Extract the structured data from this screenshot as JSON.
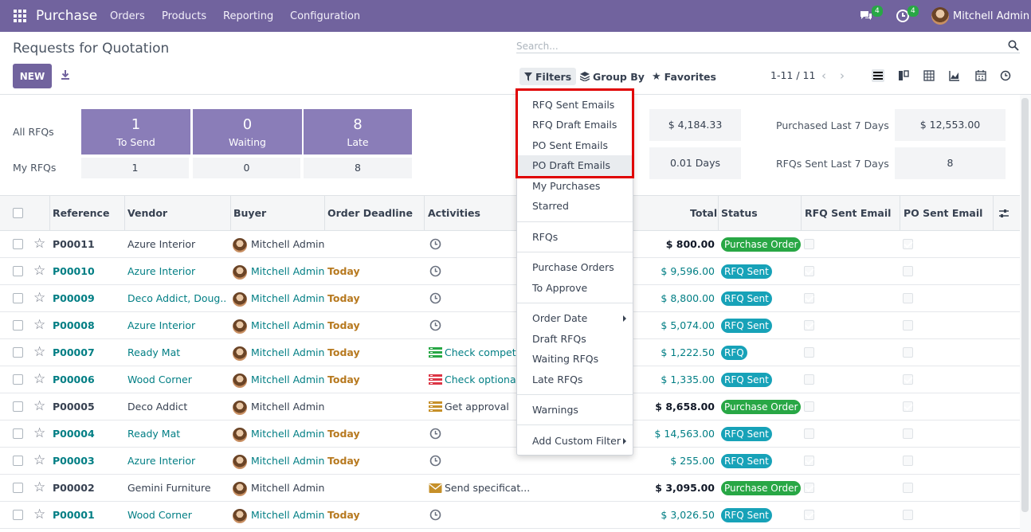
{
  "topbar": {
    "brand": "Purchase",
    "menus": [
      "Orders",
      "Products",
      "Reporting",
      "Configuration"
    ],
    "messages_badge": "4",
    "activities_badge": "4",
    "user": "Mitchell Admin"
  },
  "control": {
    "title": "Requests for Quotation",
    "new_label": "NEW",
    "search_placeholder": "Search...",
    "filters_label": "Filters",
    "groupby_label": "Group By",
    "favorites_label": "Favorites",
    "pager": "1-11 / 11"
  },
  "dashboard": {
    "all_rfqs_label": "All RFQs",
    "my_rfqs_label": "My RFQs",
    "tiles": [
      {
        "value": "1",
        "label": "To Send"
      },
      {
        "value": "0",
        "label": "Waiting"
      },
      {
        "value": "8",
        "label": "Late"
      }
    ],
    "my_values": [
      "1",
      "0",
      "8"
    ],
    "kpis": {
      "avg_order_value": "$ 4,184.33",
      "lead_time": "0.01 Days",
      "purchased_label": "Purchased Last 7 Days",
      "purchased_value": "$ 12,553.00",
      "rfqs_sent_label": "RFQs Sent Last 7 Days",
      "rfqs_sent_value": "8"
    }
  },
  "table": {
    "headers": {
      "reference": "Reference",
      "vendor": "Vendor",
      "buyer": "Buyer",
      "deadline": "Order Deadline",
      "activities": "Activities",
      "total": "Total",
      "status": "Status",
      "rfq_sent": "RFQ Sent Email",
      "po_sent": "PO Sent Email"
    },
    "rows": [
      {
        "ref": "P00011",
        "vendor": "Azure Interior",
        "buyer": "Mitchell Admin",
        "deadline": "",
        "activity": "",
        "total": "$ 800.00",
        "status": "Purchase Order"
      },
      {
        "ref": "P00010",
        "vendor": "Azure Interior",
        "buyer": "Mitchell Admin",
        "deadline": "Today",
        "activity": "",
        "total": "$ 9,596.00",
        "status": "RFQ Sent"
      },
      {
        "ref": "P00009",
        "vendor": "Deco Addict, Doug...",
        "buyer": "Mitchell Admin",
        "deadline": "Today",
        "activity": "",
        "total": "$ 8,800.00",
        "status": "RFQ Sent"
      },
      {
        "ref": "P00008",
        "vendor": "Azure Interior",
        "buyer": "Mitchell Admin",
        "deadline": "Today",
        "activity": "",
        "total": "$ 5,074.00",
        "status": "RFQ Sent"
      },
      {
        "ref": "P00007",
        "vendor": "Ready Mat",
        "buyer": "Mitchell Admin",
        "deadline": "Today",
        "activity": "Check competi...",
        "total": "$ 1,222.50",
        "status": "RFQ"
      },
      {
        "ref": "P00006",
        "vendor": "Wood Corner",
        "buyer": "Mitchell Admin",
        "deadline": "Today",
        "activity": "Check optional ...",
        "total": "$ 1,335.00",
        "status": "RFQ Sent"
      },
      {
        "ref": "P00005",
        "vendor": "Deco Addict",
        "buyer": "Mitchell Admin",
        "deadline": "",
        "activity": "Get approval",
        "total": "$ 8,658.00",
        "status": "Purchase Order"
      },
      {
        "ref": "P00004",
        "vendor": "Ready Mat",
        "buyer": "Mitchell Admin",
        "deadline": "Today",
        "activity": "",
        "total": "$ 14,563.00",
        "status": "RFQ Sent"
      },
      {
        "ref": "P00003",
        "vendor": "Azure Interior",
        "buyer": "Mitchell Admin",
        "deadline": "Today",
        "activity": "",
        "total": "$ 255.00",
        "status": "RFQ Sent"
      },
      {
        "ref": "P00002",
        "vendor": "Gemini Furniture",
        "buyer": "Mitchell Admin",
        "deadline": "",
        "activity": "Send specificat...",
        "total": "$ 3,095.00",
        "status": "Purchase Order"
      },
      {
        "ref": "P00001",
        "vendor": "Wood Corner",
        "buyer": "Mitchell Admin",
        "deadline": "Today",
        "activity": "",
        "total": "$ 3,026.50",
        "status": "RFQ Sent"
      }
    ]
  },
  "filters_menu": {
    "items": [
      "RFQ Sent Emails",
      "RFQ Draft Emails",
      "PO Sent Emails",
      "PO Draft Emails",
      "My Purchases",
      "Starred",
      "RFQs",
      "Purchase Orders",
      "To Approve",
      "Order Date",
      "Draft RFQs",
      "Waiting RFQs",
      "Late RFQs",
      "Warnings",
      "Add Custom Filter"
    ]
  },
  "colors": {
    "brand": "#71639e",
    "link": "#017e84",
    "status_po": "#28a745",
    "status_sent": "#17a2b8",
    "highlight": "#e00000"
  }
}
